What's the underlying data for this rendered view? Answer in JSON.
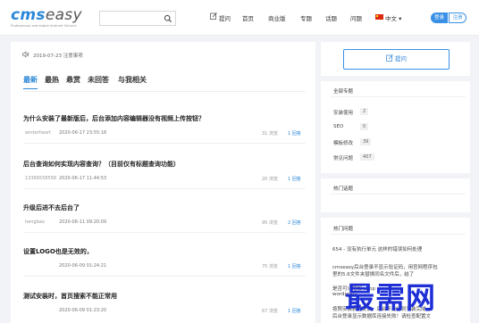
{
  "header": {
    "logo_main_a": "cms",
    "logo_main_b": "easy",
    "logo_sub": "Professional and stable Internet Service",
    "search_placeholder": "",
    "nav": [
      {
        "label": "提问"
      },
      {
        "label": "首页"
      },
      {
        "label": "商业版"
      },
      {
        "label": "专题"
      },
      {
        "label": "话题"
      },
      {
        "label": "问题"
      }
    ],
    "lang": "中文 ▾",
    "login": "登录",
    "register": "注册"
  },
  "notice": "2019-07-23 注意事项",
  "tabs": [
    "最新",
    "最热",
    "悬赏",
    "未回答",
    "与我相关"
  ],
  "questions": [
    {
      "title": "为什么安装了最新版后，后台添加内容编辑器没有视频上传按钮？",
      "user": "winterheart",
      "time": "2020-06-17 23:55:18",
      "views": "31 浏览",
      "answers": "1 回答"
    },
    {
      "title": "后台查询如何实现内容查询？（目前仅有标题查询功能）",
      "user": "13366558558",
      "time": "2020-06-17 11:44:53",
      "views": "20 浏览",
      "answers": "1 回答"
    },
    {
      "title": "升级后进不去后台了",
      "user": "hengbao",
      "time": "2020-06-11 09:20:09",
      "views": "95 浏览",
      "answers": "2 回答"
    },
    {
      "title": "设置LOGO也是无效的，",
      "user": "",
      "time": "2020-06-09 01:24:21",
      "views": "75 浏览",
      "answers": "1 回答"
    },
    {
      "title": "测试安装时，首页搜索不能正常用",
      "user": "",
      "time": "2020-06-09 01:23:20",
      "views": "67 浏览",
      "answers": "1 回答"
    }
  ],
  "sidebar": {
    "ask_label": "提问",
    "all_topics_title": "全部专题",
    "categories": [
      {
        "name": "安装使用",
        "count": "2"
      },
      {
        "name": "SEO",
        "count": "0"
      },
      {
        "name": "模板修改",
        "count": "39"
      },
      {
        "name": "常见问题",
        "count": "407"
      }
    ],
    "hot_topics_title": "热门话题",
    "hot_questions_title": "热门问题",
    "hot_questions": [
      "654 - 没有执行单元 这样的错误如何处理",
      "cmseasy后台登录不显示验证码，用官网程序包",
      "里的5.6文件夹替换同名文件后，结了",
      "是否可以增加 shop",
      "wordpress",
      "按照安装教程安装，后台不能持到安装完成",
      "后台登录显示数据库连接失败！请检查配置文"
    ]
  },
  "watermark": "最需网"
}
